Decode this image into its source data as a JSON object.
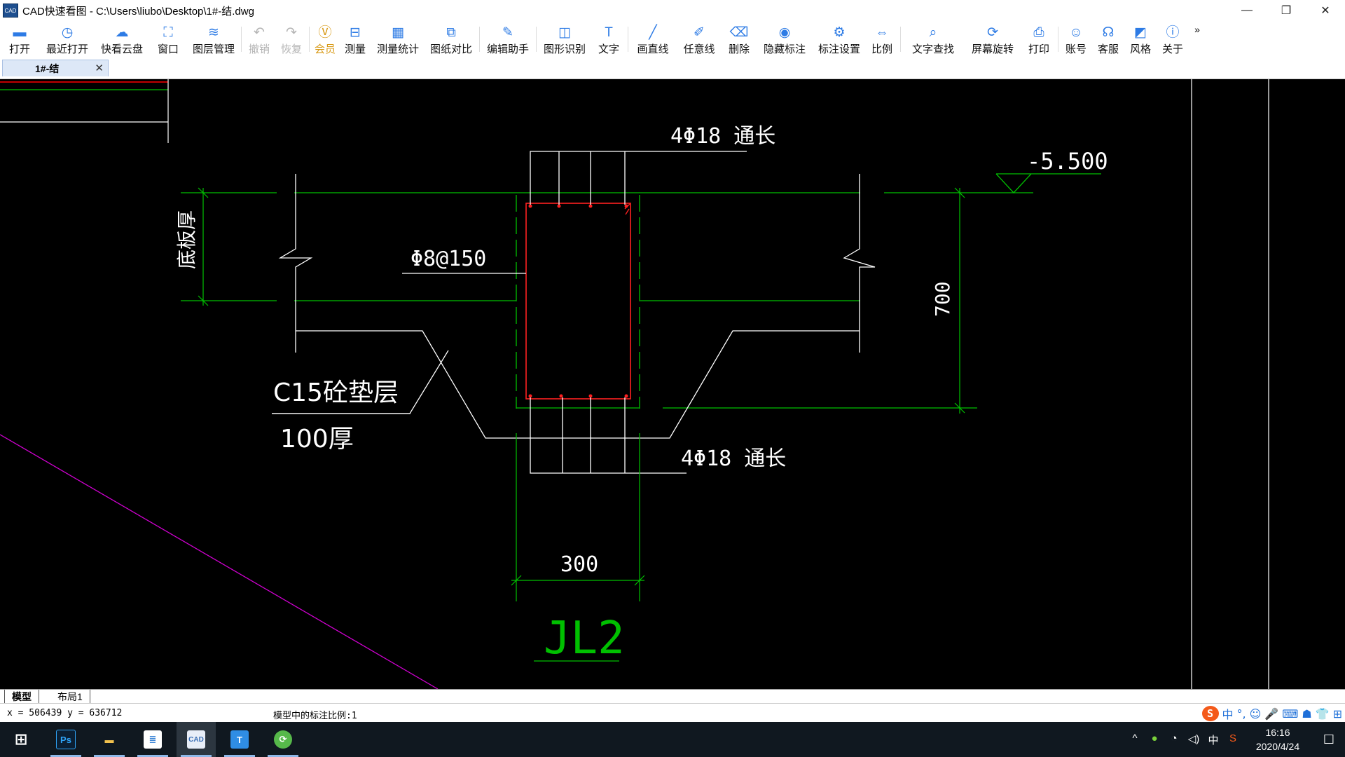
{
  "titlebar": {
    "title": "CAD快速看图 - C:\\Users\\liubo\\Desktop\\1#-结.dwg",
    "logo_text": "CAD",
    "minimize": "—",
    "restore": "❐",
    "close": "✕"
  },
  "toolbar": [
    {
      "id": "open",
      "label": "打开",
      "icon": "folder-icon",
      "glyph": "▬"
    },
    {
      "id": "recent",
      "label": "最近打开",
      "icon": "clock-icon",
      "glyph": "◷"
    },
    {
      "id": "cloud",
      "label": "快看云盘",
      "icon": "cloud-icon",
      "glyph": "☁"
    },
    {
      "id": "window",
      "label": "窗口",
      "icon": "window-icon",
      "glyph": "⛶"
    },
    {
      "id": "layers",
      "label": "图层管理",
      "icon": "layers-icon",
      "glyph": "≋"
    },
    {
      "id": "undo",
      "label": "撤销",
      "icon": "undo-icon",
      "glyph": "↶",
      "disabled": true
    },
    {
      "id": "redo",
      "label": "恢复",
      "icon": "redo-icon",
      "glyph": "↷",
      "disabled": true
    },
    {
      "id": "vip",
      "label": "会员",
      "icon": "vip-icon",
      "glyph": "Ⓥ",
      "vip": true
    },
    {
      "id": "measure",
      "label": "测量",
      "icon": "ruler-icon",
      "glyph": "⊟"
    },
    {
      "id": "measure_stats",
      "label": "测量统计",
      "icon": "stats-icon",
      "glyph": "▦"
    },
    {
      "id": "compare",
      "label": "图纸对比",
      "icon": "compare-icon",
      "glyph": "⧉"
    },
    {
      "id": "edit",
      "label": "编辑助手",
      "icon": "edit-assistant-icon",
      "glyph": "✎"
    },
    {
      "id": "recognize",
      "label": "图形识别",
      "icon": "shape-recognize-icon",
      "glyph": "◫"
    },
    {
      "id": "text",
      "label": "文字",
      "icon": "text-icon",
      "glyph": "T"
    },
    {
      "id": "line",
      "label": "画直线",
      "icon": "line-icon",
      "glyph": "╱"
    },
    {
      "id": "freeline",
      "label": "任意线",
      "icon": "pen-icon",
      "glyph": "✐"
    },
    {
      "id": "delete",
      "label": "删除",
      "icon": "eraser-icon",
      "glyph": "⌫"
    },
    {
      "id": "hide",
      "label": "隐藏标注",
      "icon": "eye-icon",
      "glyph": "◉"
    },
    {
      "id": "annot_settings",
      "label": "标注设置",
      "icon": "settings-icon",
      "glyph": "⚙"
    },
    {
      "id": "scale",
      "label": "比例",
      "icon": "scale-icon",
      "glyph": "⇔"
    },
    {
      "id": "find_text",
      "label": "文字查找",
      "icon": "find-text-icon",
      "glyph": "⌕"
    },
    {
      "id": "rotate",
      "label": "屏幕旋转",
      "icon": "rotate-icon",
      "glyph": "⟳"
    },
    {
      "id": "print",
      "label": "打印",
      "icon": "printer-icon",
      "glyph": "⎙"
    },
    {
      "id": "account",
      "label": "账号",
      "icon": "user-icon",
      "glyph": "☺"
    },
    {
      "id": "service",
      "label": "客服",
      "icon": "headset-icon",
      "glyph": "☊"
    },
    {
      "id": "style",
      "label": "风格",
      "icon": "style-icon",
      "glyph": "◩"
    },
    {
      "id": "about",
      "label": "关于",
      "icon": "info-icon",
      "glyph": "ⓘ"
    }
  ],
  "toolbar_more": "»",
  "tab": {
    "label": "1#-结",
    "close": "✕"
  },
  "drawing": {
    "top_rebar": "4Φ18  通长",
    "bottom_rebar": "4Φ18  通长",
    "stirrup": "Φ8@150",
    "elevation": "-5.500",
    "slab_thickness": "底板厚",
    "height_dim": "700",
    "cushion": "C15砼垫层",
    "cushion_thickness": "100厚",
    "width_dim": "300",
    "beam_id": "JL2"
  },
  "layout_tabs": {
    "model": "模型",
    "layout1": "布局1"
  },
  "status": {
    "coords": "x = 506439 y = 636712",
    "scale_text": "模型中的标注比例:1",
    "ime": [
      "中",
      "°,",
      "☺",
      "🎤",
      "⌨",
      "☗",
      "👕",
      "⊞"
    ],
    "ime_logo": "S"
  },
  "taskbar": {
    "apps": [
      {
        "id": "start",
        "label": "⊞",
        "color": "#ffffff"
      },
      {
        "id": "ps",
        "label": "Ps",
        "color": "#2fa3f7"
      },
      {
        "id": "explorer",
        "label": "▬",
        "color": "#f2c14e"
      },
      {
        "id": "notes",
        "label": "≣",
        "color": "#3d86d6"
      },
      {
        "id": "cad",
        "label": "CAD",
        "color": "#3a6fb5"
      },
      {
        "id": "txt",
        "label": "T",
        "color": "#2f8de4"
      },
      {
        "id": "sync",
        "label": "⟳",
        "color": "#56b84a"
      }
    ],
    "tray": [
      "^",
      "●",
      "◔",
      "◁)",
      "中",
      "S"
    ],
    "time": "16:16",
    "date": "2020/4/24",
    "notify": "☐"
  }
}
